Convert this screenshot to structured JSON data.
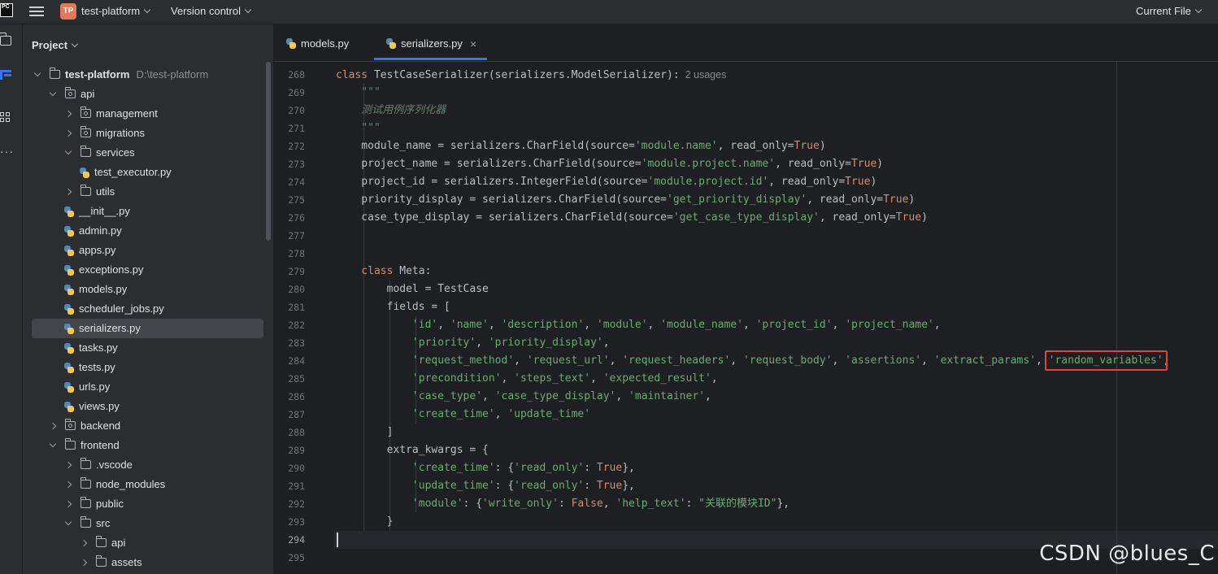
{
  "topbar": {
    "ide_logo_text": "PC",
    "project_badge": "TP",
    "project_name": "test-platform",
    "vcs_menu": "Version control",
    "run_config": "Current File"
  },
  "project_panel": {
    "title": "Project",
    "tree": [
      {
        "label": "test-platform",
        "path": "D:\\test-platform",
        "kind": "folder",
        "depth": 0,
        "state": "open",
        "bold": true
      },
      {
        "label": "api",
        "kind": "pkg",
        "depth": 1,
        "state": "open"
      },
      {
        "label": "management",
        "kind": "pkg",
        "depth": 2,
        "state": "closed"
      },
      {
        "label": "migrations",
        "kind": "pkg",
        "depth": 2,
        "state": "closed"
      },
      {
        "label": "services",
        "kind": "folder",
        "depth": 2,
        "state": "open"
      },
      {
        "label": "test_executor.py",
        "kind": "py",
        "depth": 3,
        "state": "leaf"
      },
      {
        "label": "utils",
        "kind": "folder",
        "depth": 2,
        "state": "closed"
      },
      {
        "label": "__init__.py",
        "kind": "py",
        "depth": 2,
        "state": "leaf"
      },
      {
        "label": "admin.py",
        "kind": "py",
        "depth": 2,
        "state": "leaf"
      },
      {
        "label": "apps.py",
        "kind": "py",
        "depth": 2,
        "state": "leaf"
      },
      {
        "label": "exceptions.py",
        "kind": "py",
        "depth": 2,
        "state": "leaf"
      },
      {
        "label": "models.py",
        "kind": "py",
        "depth": 2,
        "state": "leaf"
      },
      {
        "label": "scheduler_jobs.py",
        "kind": "py",
        "depth": 2,
        "state": "leaf"
      },
      {
        "label": "serializers.py",
        "kind": "py",
        "depth": 2,
        "state": "leaf",
        "selected": true
      },
      {
        "label": "tasks.py",
        "kind": "py",
        "depth": 2,
        "state": "leaf"
      },
      {
        "label": "tests.py",
        "kind": "py",
        "depth": 2,
        "state": "leaf"
      },
      {
        "label": "urls.py",
        "kind": "py",
        "depth": 2,
        "state": "leaf"
      },
      {
        "label": "views.py",
        "kind": "py",
        "depth": 2,
        "state": "leaf"
      },
      {
        "label": "backend",
        "kind": "pkg",
        "depth": 1,
        "state": "closed"
      },
      {
        "label": "frontend",
        "kind": "folder",
        "depth": 1,
        "state": "open"
      },
      {
        "label": ".vscode",
        "kind": "folder",
        "depth": 2,
        "state": "closed"
      },
      {
        "label": "node_modules",
        "kind": "folder",
        "depth": 2,
        "state": "closed"
      },
      {
        "label": "public",
        "kind": "folder",
        "depth": 2,
        "state": "closed"
      },
      {
        "label": "src",
        "kind": "folder",
        "depth": 2,
        "state": "open"
      },
      {
        "label": "api",
        "kind": "folder",
        "depth": 3,
        "state": "closed"
      },
      {
        "label": "assets",
        "kind": "folder",
        "depth": 3,
        "state": "closed"
      }
    ]
  },
  "tabs": [
    {
      "label": "models.py",
      "active": false
    },
    {
      "label": "serializers.py",
      "active": true,
      "close": "×"
    }
  ],
  "editor": {
    "current_line": 294,
    "lines": [
      {
        "n": "268",
        "tokens": [
          [
            "kw",
            "class "
          ],
          [
            "cls",
            "TestCaseSerializer(serializers.ModelSerializer):"
          ],
          [
            "hint",
            "  2 usages"
          ]
        ]
      },
      {
        "n": "269",
        "tokens": [
          [
            "doc",
            "    \"\"\""
          ]
        ]
      },
      {
        "n": "270",
        "tokens": [
          [
            "doc",
            "    测试用例序列化器"
          ]
        ]
      },
      {
        "n": "271",
        "tokens": [
          [
            "doc",
            "    \"\"\""
          ]
        ]
      },
      {
        "n": "272",
        "tokens": [
          [
            "cls",
            "    module_name = serializers.CharField(source="
          ],
          [
            "str",
            "'module.name'"
          ],
          [
            "cls",
            ", read_only="
          ],
          [
            "kw",
            "True"
          ],
          [
            "cls",
            ")"
          ]
        ]
      },
      {
        "n": "273",
        "tokens": [
          [
            "cls",
            "    project_name = serializers.CharField(source="
          ],
          [
            "str",
            "'module.project.name'"
          ],
          [
            "cls",
            ", read_only="
          ],
          [
            "kw",
            "True"
          ],
          [
            "cls",
            ")"
          ]
        ]
      },
      {
        "n": "274",
        "tokens": [
          [
            "cls",
            "    project_id = serializers.IntegerField(source="
          ],
          [
            "str",
            "'module.project.id'"
          ],
          [
            "cls",
            ", read_only="
          ],
          [
            "kw",
            "True"
          ],
          [
            "cls",
            ")"
          ]
        ]
      },
      {
        "n": "275",
        "tokens": [
          [
            "cls",
            "    priority_display = serializers.CharField(source="
          ],
          [
            "str",
            "'get_priority_display'"
          ],
          [
            "cls",
            ", read_only="
          ],
          [
            "kw",
            "True"
          ],
          [
            "cls",
            ")"
          ]
        ]
      },
      {
        "n": "276",
        "tokens": [
          [
            "cls",
            "    case_type_display = serializers.CharField(source="
          ],
          [
            "str",
            "'get_case_type_display'"
          ],
          [
            "cls",
            ", read_only="
          ],
          [
            "kw",
            "True"
          ],
          [
            "cls",
            ")"
          ]
        ]
      },
      {
        "n": "277",
        "tokens": []
      },
      {
        "n": "278",
        "tokens": []
      },
      {
        "n": "279",
        "tokens": [
          [
            "kw",
            "    class "
          ],
          [
            "cls",
            "Meta:"
          ]
        ]
      },
      {
        "n": "280",
        "tokens": [
          [
            "cls",
            "        model = TestCase"
          ]
        ]
      },
      {
        "n": "281",
        "tokens": [
          [
            "cls",
            "        fields = ["
          ]
        ]
      },
      {
        "n": "282",
        "tokens": [
          [
            "cls",
            "            "
          ],
          [
            "str",
            "'id'"
          ],
          [
            "cls",
            ", "
          ],
          [
            "str",
            "'name'"
          ],
          [
            "cls",
            ", "
          ],
          [
            "str",
            "'description'"
          ],
          [
            "cls",
            ", "
          ],
          [
            "str",
            "'module'"
          ],
          [
            "cls",
            ", "
          ],
          [
            "str",
            "'module_name'"
          ],
          [
            "cls",
            ", "
          ],
          [
            "str",
            "'project_id'"
          ],
          [
            "cls",
            ", "
          ],
          [
            "str",
            "'project_name'"
          ],
          [
            "cls",
            ","
          ]
        ]
      },
      {
        "n": "283",
        "tokens": [
          [
            "cls",
            "            "
          ],
          [
            "str",
            "'priority'"
          ],
          [
            "cls",
            ", "
          ],
          [
            "str",
            "'priority_display'"
          ],
          [
            "cls",
            ","
          ]
        ]
      },
      {
        "n": "284",
        "tokens": [
          [
            "cls",
            "            "
          ],
          [
            "str",
            "'request_method'"
          ],
          [
            "cls",
            ", "
          ],
          [
            "str",
            "'request_url'"
          ],
          [
            "cls",
            ", "
          ],
          [
            "str",
            "'request_headers'"
          ],
          [
            "cls",
            ", "
          ],
          [
            "str",
            "'request_body'"
          ],
          [
            "cls",
            ", "
          ],
          [
            "str",
            "'assertions'"
          ],
          [
            "cls",
            ", "
          ],
          [
            "str",
            "'extract_params'"
          ],
          [
            "cls",
            ", "
          ],
          [
            "str",
            "'random_variables'"
          ],
          [
            "cls",
            ","
          ]
        ]
      },
      {
        "n": "285",
        "tokens": [
          [
            "cls",
            "            "
          ],
          [
            "str",
            "'precondition'"
          ],
          [
            "cls",
            ", "
          ],
          [
            "str",
            "'steps_text'"
          ],
          [
            "cls",
            ", "
          ],
          [
            "str",
            "'expected_result'"
          ],
          [
            "cls",
            ","
          ]
        ]
      },
      {
        "n": "286",
        "tokens": [
          [
            "cls",
            "            "
          ],
          [
            "str",
            "'case_type'"
          ],
          [
            "cls",
            ", "
          ],
          [
            "str",
            "'case_type_display'"
          ],
          [
            "cls",
            ", "
          ],
          [
            "str",
            "'maintainer'"
          ],
          [
            "cls",
            ","
          ]
        ]
      },
      {
        "n": "287",
        "tokens": [
          [
            "cls",
            "            "
          ],
          [
            "str",
            "'create_time'"
          ],
          [
            "cls",
            ", "
          ],
          [
            "str",
            "'update_time'"
          ]
        ]
      },
      {
        "n": "288",
        "tokens": [
          [
            "cls",
            "        ]"
          ]
        ]
      },
      {
        "n": "289",
        "tokens": [
          [
            "cls",
            "        extra_kwargs = {"
          ]
        ]
      },
      {
        "n": "290",
        "tokens": [
          [
            "cls",
            "            "
          ],
          [
            "str",
            "'create_time'"
          ],
          [
            "cls",
            ": {"
          ],
          [
            "str",
            "'read_only'"
          ],
          [
            "cls",
            ": "
          ],
          [
            "kw",
            "True"
          ],
          [
            "cls",
            "},"
          ]
        ]
      },
      {
        "n": "291",
        "tokens": [
          [
            "cls",
            "            "
          ],
          [
            "str",
            "'update_time'"
          ],
          [
            "cls",
            ": {"
          ],
          [
            "str",
            "'read_only'"
          ],
          [
            "cls",
            ": "
          ],
          [
            "kw",
            "True"
          ],
          [
            "cls",
            "},"
          ]
        ]
      },
      {
        "n": "292",
        "tokens": [
          [
            "cls",
            "            "
          ],
          [
            "str",
            "'module'"
          ],
          [
            "cls",
            ": {"
          ],
          [
            "str",
            "'write_only'"
          ],
          [
            "cls",
            ": "
          ],
          [
            "kw",
            "False"
          ],
          [
            "cls",
            ", "
          ],
          [
            "str",
            "'help_text'"
          ],
          [
            "cls",
            ": "
          ],
          [
            "str",
            "\"关联的模块ID\""
          ],
          [
            "cls",
            "},"
          ]
        ]
      },
      {
        "n": "293",
        "tokens": [
          [
            "cls",
            "        }"
          ]
        ]
      },
      {
        "n": "294",
        "tokens": []
      },
      {
        "n": "295",
        "tokens": []
      }
    ]
  },
  "watermark": "CSDN @blues_C",
  "colors": {
    "keyword": "#cf8e6d",
    "string": "#6aab73",
    "docstring": "#5f826b",
    "accent": "#3574f0",
    "highlight_box": "#e0433b"
  }
}
